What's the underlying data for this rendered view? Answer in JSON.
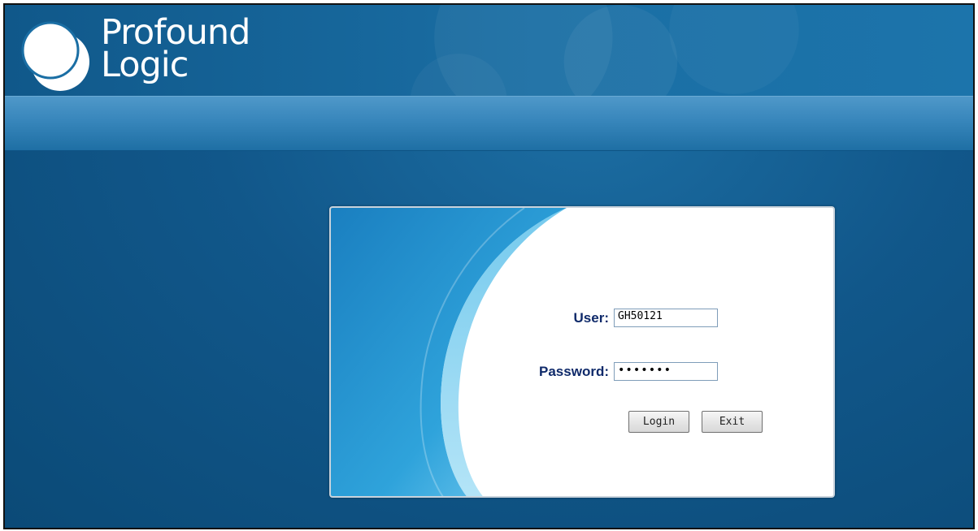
{
  "brand": {
    "line1": "Profound",
    "line2": "Logic"
  },
  "login": {
    "user_label": "User:",
    "user_value": "GH50121",
    "password_label": "Password:",
    "password_value": "•••••••",
    "login_button": "Login",
    "exit_button": "Exit"
  },
  "colors": {
    "background": "#11578a",
    "nav_band": "#3a88bd",
    "label_text": "#0f2a6a",
    "panel_swoosh": "#1e8fcf"
  }
}
